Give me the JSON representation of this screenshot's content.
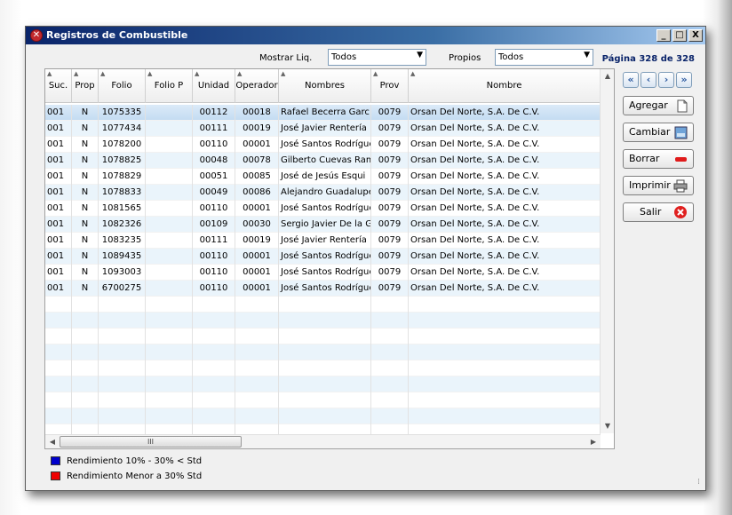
{
  "window": {
    "title": "Registros de Combustible"
  },
  "window_buttons": [
    "_",
    "□",
    "X"
  ],
  "filters": {
    "mostrar_label": "Mostrar Liq.",
    "mostrar_value": "Todos",
    "propios_label": "Propios",
    "propios_value": "Todos"
  },
  "pagination": {
    "text": "Página 328 de 328"
  },
  "nav_buttons": [
    "«",
    "‹",
    "›",
    "»"
  ],
  "actions": {
    "agregar": "Agregar",
    "cambiar": "Cambiar",
    "borrar": "Borrar",
    "imprimir": "Imprimir",
    "salir": "Salir"
  },
  "grid": {
    "columns": [
      "Suc.",
      "Prop",
      "Folio",
      "Folio P",
      "Unidad",
      "Operador",
      "Nombres",
      "Prov",
      "Nombre"
    ],
    "rows": [
      [
        "001",
        "N",
        "1075335",
        "",
        "00112",
        "00018",
        "Rafael Becerra Garc",
        "0079",
        "Orsan Del Norte, S.A. De C.V."
      ],
      [
        "001",
        "N",
        "1077434",
        "",
        "00111",
        "00019",
        "José Javier Rentería",
        "0079",
        "Orsan Del Norte, S.A. De C.V."
      ],
      [
        "001",
        "N",
        "1078200",
        "",
        "00110",
        "00001",
        "José Santos Rodrígue",
        "0079",
        "Orsan Del Norte, S.A. De C.V."
      ],
      [
        "001",
        "N",
        "1078825",
        "",
        "00048",
        "00078",
        "Gilberto Cuevas Ram",
        "0079",
        "Orsan Del Norte, S.A. De C.V."
      ],
      [
        "001",
        "N",
        "1078829",
        "",
        "00051",
        "00085",
        "José de Jesús  Esqui",
        "0079",
        "Orsan Del Norte, S.A. De C.V."
      ],
      [
        "001",
        "N",
        "1078833",
        "",
        "00049",
        "00086",
        "Alejandro Guadalupe",
        "0079",
        "Orsan Del Norte, S.A. De C.V."
      ],
      [
        "001",
        "N",
        "1081565",
        "",
        "00110",
        "00001",
        "José Santos Rodrígue",
        "0079",
        "Orsan Del Norte, S.A. De C.V."
      ],
      [
        "001",
        "N",
        "1082326",
        "",
        "00109",
        "00030",
        "Sergio Javier De la G",
        "0079",
        "Orsan Del Norte, S.A. De C.V."
      ],
      [
        "001",
        "N",
        "1083235",
        "",
        "00111",
        "00019",
        "José Javier Rentería",
        "0079",
        "Orsan Del Norte, S.A. De C.V."
      ],
      [
        "001",
        "N",
        "1089435",
        "",
        "00110",
        "00001",
        "José Santos Rodrígue",
        "0079",
        "Orsan Del Norte, S.A. De C.V."
      ],
      [
        "001",
        "N",
        "1093003",
        "",
        "00110",
        "00001",
        "José Santos Rodrígue",
        "0079",
        "Orsan Del Norte, S.A. De C.V."
      ],
      [
        "001",
        "N",
        "6700275",
        "",
        "00110",
        "00001",
        "José Santos Rodrígue",
        "0079",
        "Orsan Del Norte, S.A. De C.V."
      ]
    ],
    "empty_rows": 9,
    "scroll_thumb_label": "III"
  },
  "legend": [
    {
      "label": "Rendimiento 10% - 30% < Std",
      "color": "#0000cc"
    },
    {
      "label": "Rendimiento Menor a 30% Std",
      "color": "#ee0000"
    }
  ],
  "colors": {
    "title_start": "#0a246a",
    "selected_row": "#c4dcf2",
    "alt_row": "#eaf4fb"
  }
}
